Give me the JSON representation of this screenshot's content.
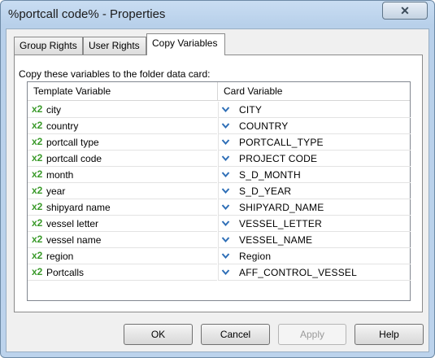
{
  "window": {
    "title": "%portcall code% - Properties",
    "close_glyph": "✕"
  },
  "tabs": [
    {
      "label": "Group Rights",
      "active": false
    },
    {
      "label": "User Rights",
      "active": false
    },
    {
      "label": "Copy Variables",
      "active": true
    }
  ],
  "panel": {
    "instruction": "Copy these variables to the folder data card:",
    "columns": {
      "template": "Template Variable",
      "card": "Card Variable"
    },
    "x2_label": "x2",
    "rows": [
      {
        "template": "city",
        "card": "CITY"
      },
      {
        "template": "country",
        "card": "COUNTRY"
      },
      {
        "template": "portcall type",
        "card": "PORTCALL_TYPE"
      },
      {
        "template": "portcall code",
        "card": "PROJECT CODE"
      },
      {
        "template": "month",
        "card": "S_D_MONTH"
      },
      {
        "template": "year",
        "card": "S_D_YEAR"
      },
      {
        "template": "shipyard name",
        "card": "SHIPYARD_NAME"
      },
      {
        "template": "vessel letter",
        "card": "VESSEL_LETTER"
      },
      {
        "template": "vessel name",
        "card": "VESSEL_NAME"
      },
      {
        "template": "region",
        "card": "Region"
      },
      {
        "template": "Portcalls",
        "card": "AFF_CONTROL_VESSEL"
      }
    ]
  },
  "buttons": {
    "ok": "OK",
    "cancel": "Cancel",
    "apply": "Apply",
    "help": "Help"
  },
  "colors": {
    "x2_green": "#3a9a2a",
    "dropdown_blue": "#2f6fb7"
  }
}
